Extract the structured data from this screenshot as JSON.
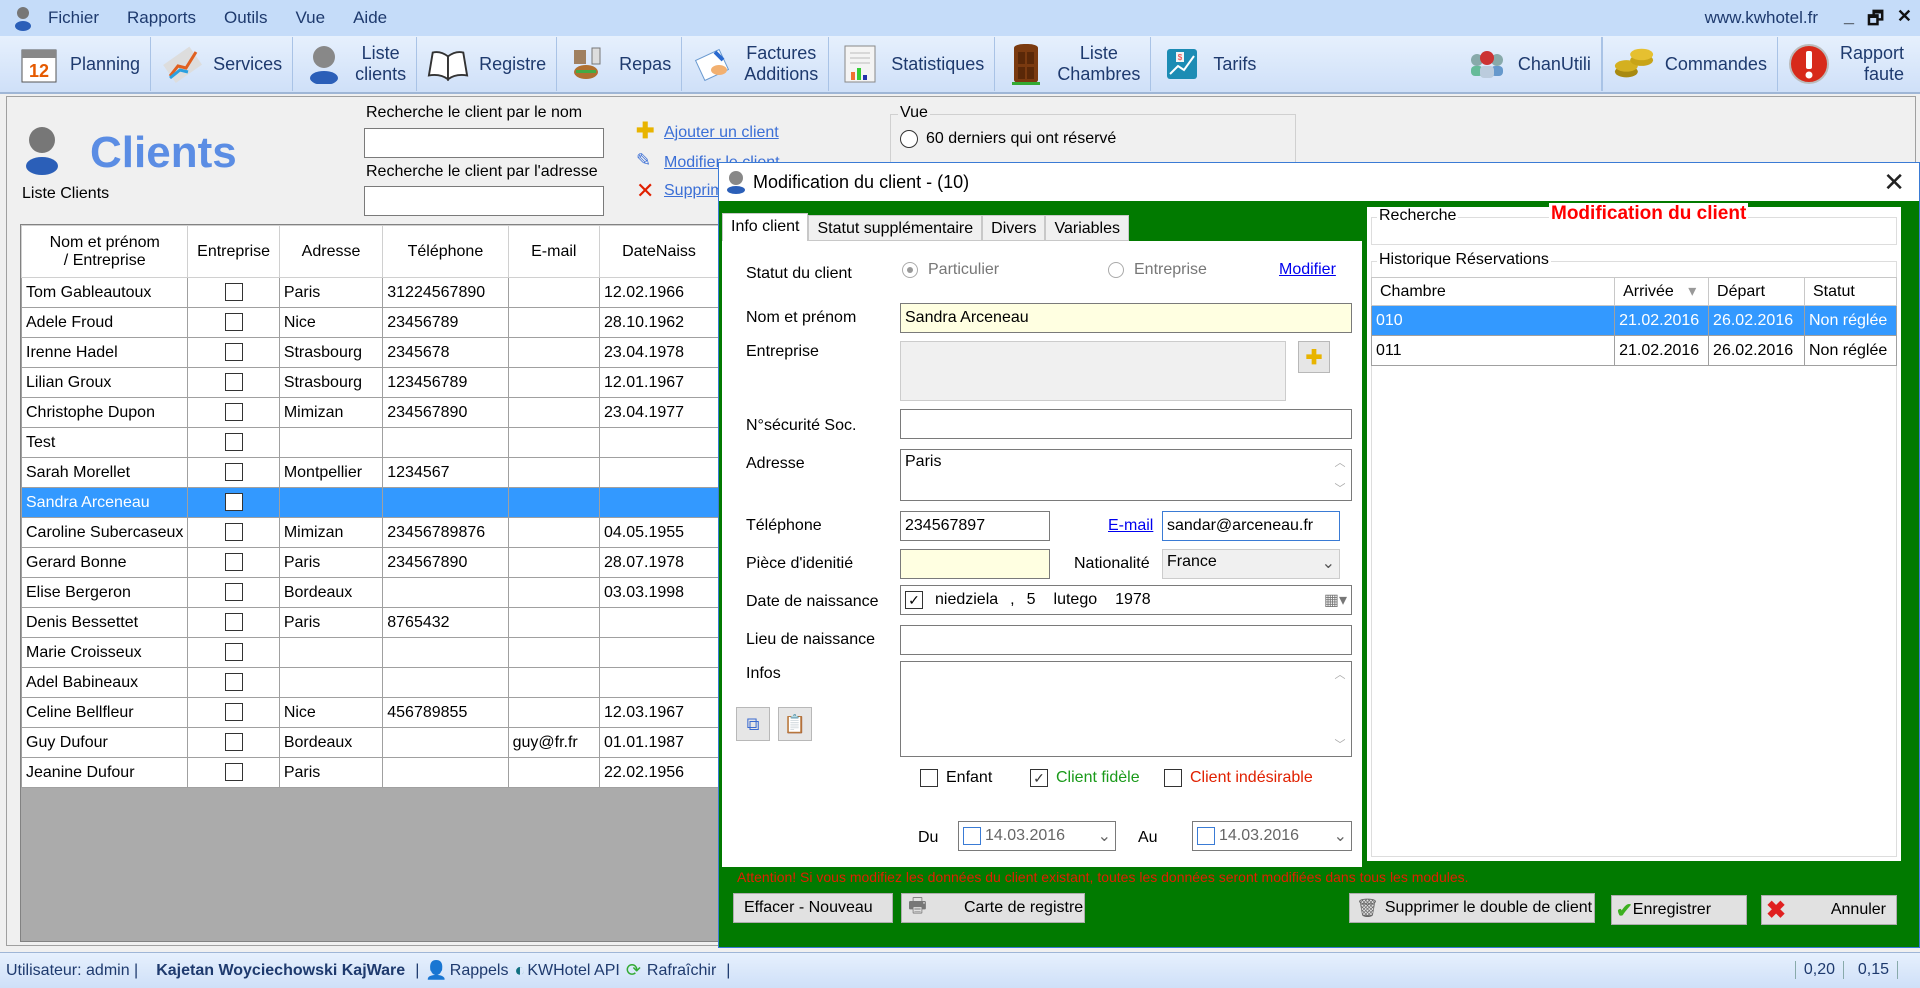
{
  "menubar": {
    "items": [
      "Fichier",
      "Rapports",
      "Outils",
      "Vue",
      "Aide"
    ],
    "site": "www.kwhotel.fr",
    "window_controls": {
      "minimize": "_",
      "restore": "🗗",
      "close": "✕"
    }
  },
  "toolbar": {
    "left": [
      {
        "id": "planning",
        "label": "Planning",
        "icon": "calendar-icon"
      },
      {
        "id": "services",
        "label": "Services",
        "icon": "services-chart-icon"
      },
      {
        "id": "liste-clients",
        "label": "Liste\nclients",
        "icon": "client-icon"
      },
      {
        "id": "registre",
        "label": "Registre",
        "icon": "book-icon"
      },
      {
        "id": "repas",
        "label": "Repas",
        "icon": "meal-icon"
      },
      {
        "id": "factures",
        "label": "Factures\nAdditions",
        "icon": "invoice-icon"
      },
      {
        "id": "statistiques",
        "label": "Statistiques",
        "icon": "statistics-icon"
      },
      {
        "id": "liste-chambres",
        "label": "Liste\nChambres",
        "icon": "door-icon"
      },
      {
        "id": "tarifs",
        "label": "Tarifs",
        "icon": "tariff-icon"
      }
    ],
    "right": [
      {
        "id": "chanutili",
        "label": "ChanUtili",
        "icon": "users-group-icon"
      },
      {
        "id": "commandes",
        "label": "Commandes",
        "icon": "coins-icon"
      },
      {
        "id": "rapport-faute",
        "label": "Rapport\nfaute",
        "icon": "warning-icon"
      }
    ]
  },
  "clients_page": {
    "title": "Clients",
    "subtitle": "Liste Clients",
    "search_name_label": "Recherche le client par le nom",
    "search_name_value": "",
    "search_address_label": "Recherche le client par l'adresse",
    "search_address_value": "",
    "actions": {
      "add": "Ajouter un client",
      "modify": "Modifier le client",
      "delete": "Supprimer"
    },
    "vue": {
      "label": "Vue",
      "option1": "60 derniers qui ont réservé"
    }
  },
  "clients_table": {
    "columns": [
      "Nom et prénom\n/ Entreprise",
      "Entreprise",
      "Adresse",
      "Téléphone",
      "E-mail",
      "DateNaiss"
    ],
    "selected_index": 7,
    "rows": [
      {
        "name": "Tom Gableautoux",
        "entreprise": false,
        "adresse": "Paris",
        "tel": "31224567890",
        "email": "",
        "naiss": "12.02.1966"
      },
      {
        "name": "Adele Froud",
        "entreprise": false,
        "adresse": "Nice",
        "tel": "23456789",
        "email": "",
        "naiss": "28.10.1962"
      },
      {
        "name": "Irenne Hadel",
        "entreprise": false,
        "adresse": "Strasbourg",
        "tel": "2345678",
        "email": "",
        "naiss": "23.04.1978"
      },
      {
        "name": "Lilian Groux",
        "entreprise": false,
        "adresse": "Strasbourg",
        "tel": "123456789",
        "email": "",
        "naiss": "12.01.1967"
      },
      {
        "name": "Christophe Dupon",
        "entreprise": false,
        "adresse": "Mimizan",
        "tel": "234567890",
        "email": "",
        "naiss": "23.04.1977"
      },
      {
        "name": "Test",
        "entreprise": false,
        "adresse": "",
        "tel": "",
        "email": "",
        "naiss": ""
      },
      {
        "name": "Sarah Morellet",
        "entreprise": false,
        "adresse": "Montpellier",
        "tel": "1234567",
        "email": "",
        "naiss": ""
      },
      {
        "name": "Sandra Arceneau",
        "entreprise": false,
        "adresse": "",
        "tel": "",
        "email": "",
        "naiss": ""
      },
      {
        "name": "Caroline Subercaseux",
        "entreprise": false,
        "adresse": "Mimizan",
        "tel": "23456789876",
        "email": "",
        "naiss": "04.05.1955"
      },
      {
        "name": "Gerard Bonne",
        "entreprise": false,
        "adresse": "Paris",
        "tel": "234567890",
        "email": "",
        "naiss": "28.07.1978"
      },
      {
        "name": "Elise Bergeron",
        "entreprise": false,
        "adresse": "Bordeaux",
        "tel": "",
        "email": "",
        "naiss": "03.03.1998"
      },
      {
        "name": "Denis Bessettet",
        "entreprise": false,
        "adresse": "Paris",
        "tel": "8765432",
        "email": "",
        "naiss": ""
      },
      {
        "name": "Marie Croisseux",
        "entreprise": false,
        "adresse": "",
        "tel": "",
        "email": "",
        "naiss": ""
      },
      {
        "name": "Adel Babineaux",
        "entreprise": false,
        "adresse": "",
        "tel": "",
        "email": "",
        "naiss": ""
      },
      {
        "name": "Celine Bellfleur",
        "entreprise": false,
        "adresse": "Nice",
        "tel": "456789855",
        "email": "",
        "naiss": "12.03.1967"
      },
      {
        "name": "Guy Dufour",
        "entreprise": false,
        "adresse": "Bordeaux",
        "tel": "",
        "email": "guy@fr.fr",
        "naiss": "01.01.1987"
      },
      {
        "name": "Jeanine Dufour",
        "entreprise": false,
        "adresse": "Paris",
        "tel": "",
        "email": "",
        "naiss": "22.02.1956"
      }
    ]
  },
  "dialog": {
    "title": "Modification du client - (10)",
    "close": "✕",
    "tabs": [
      "Info client",
      "Statut supplémentaire",
      "Divers",
      "Variables"
    ],
    "active_tab": 0,
    "form": {
      "statut_label": "Statut du client",
      "particulier": "Particulier",
      "entreprise_radio": "Entreprise",
      "modifier": "Modifier",
      "nom_label": "Nom et prénom",
      "nom_value": "Sandra Arceneau",
      "entreprise_label": "Entreprise",
      "entreprise_value": "",
      "secu_label": "N°sécurité Soc.",
      "secu_value": "",
      "adresse_label": "Adresse",
      "adresse_value": "Paris",
      "tel_label": "Téléphone",
      "tel_value": "234567897",
      "email_link": "E-mail",
      "email_value": "sandar@arceneau.fr",
      "piece_label": "Pièce d'idenitié",
      "piece_value": "",
      "nationalite_label": "Nationalité",
      "nationalite_value": "France",
      "date_label": "Date de naissance",
      "date_checked": true,
      "date_day_name": "niedziela",
      "date_sep": ",",
      "date_day": "5",
      "date_month": "lutego",
      "date_year": "1978",
      "lieu_label": "Lieu de naissance",
      "lieu_value": "",
      "infos_label": "Infos",
      "infos_value": "",
      "enfant": "Enfant",
      "enfant_checked": false,
      "fidele": "Client fidèle",
      "fidele_checked": true,
      "indesirable": "Client indésirable",
      "indesirable_checked": false,
      "du_label": "Du",
      "du_value": "14.03.2016",
      "au_label": "Au",
      "au_value": "14.03.2016"
    },
    "right": {
      "recherche_label": "Recherche",
      "heading": "Modification du client",
      "historique_label": "Historique Réservations",
      "columns": [
        "Chambre",
        "Arrivée",
        "Départ",
        "Statut"
      ],
      "rows": [
        {
          "chambre": "010",
          "arrivee": "21.02.2016",
          "depart": "26.02.2016",
          "statut": "Non réglée"
        },
        {
          "chambre": "011",
          "arrivee": "21.02.2016",
          "depart": "26.02.2016",
          "statut": "Non réglée"
        }
      ],
      "selected_index": 0
    },
    "warning": "Attention! Si vous modifiez les données du client existant, toutes les données seront modifiées dans tous les modules.",
    "buttons": {
      "effacer": "Effacer - Nouveau",
      "carte": "Carte de registre",
      "supprimer_double": "Supprimer le double de client",
      "enregistrer": "Enregistrer",
      "annuler": "Annuler"
    }
  },
  "statusbar": {
    "user": "Utilisateur: admin |",
    "company": "Kajetan Woyciechowski KajWare",
    "sep": "|",
    "rappels": "Rappels",
    "api": "KWHotel API",
    "refresh": "Rafraîchir",
    "end_sep": "|",
    "val1": "0,20",
    "val2": "0,15"
  },
  "colors": {
    "dialog_green": "#017a00",
    "selection_blue": "#3399ff",
    "title_blue": "#5b8de4",
    "warning_red": "#e02000",
    "fidele_green": "#1a9a1a"
  }
}
